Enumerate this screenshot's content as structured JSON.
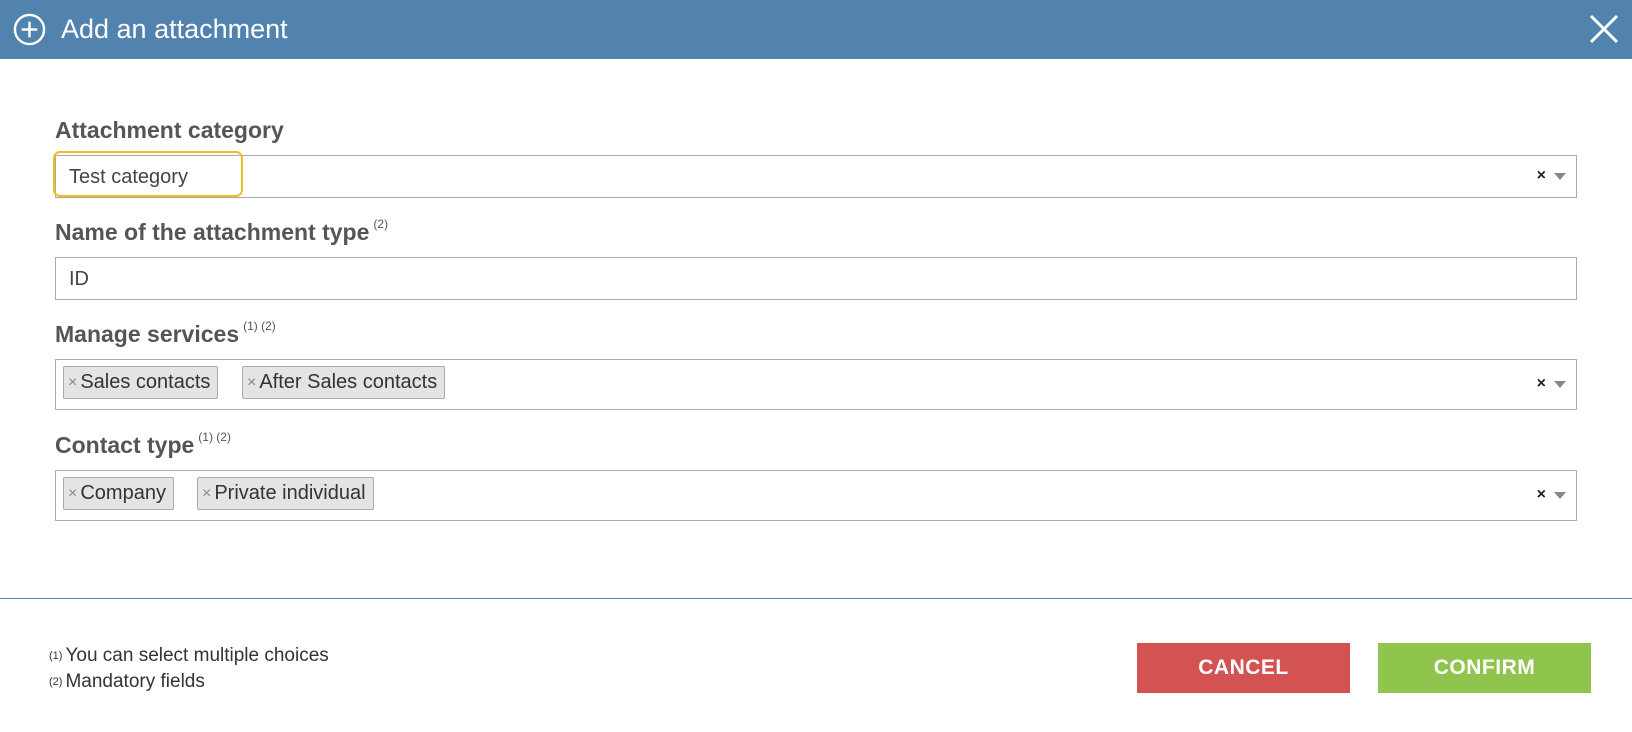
{
  "dialog": {
    "title": "Add an attachment"
  },
  "fields": {
    "category": {
      "label": "Attachment category",
      "value": "Test category"
    },
    "type_name": {
      "label": "Name of the attachment type",
      "marks": "(2)",
      "value": "ID"
    },
    "services": {
      "label": "Manage services",
      "marks": "(1) (2)",
      "tags": [
        "Sales contacts",
        "After Sales contacts"
      ]
    },
    "contact_type": {
      "label": "Contact type",
      "marks": "(1) (2)",
      "tags": [
        "Company",
        "Private individual"
      ]
    }
  },
  "footer": {
    "notes": [
      {
        "mark": "(1)",
        "text": "You can select multiple choices"
      },
      {
        "mark": "(2)",
        "text": "Mandatory fields"
      }
    ],
    "cancel_label": "CANCEL",
    "confirm_label": "CONFIRM"
  },
  "colors": {
    "header": "#5282ae",
    "cancel": "#d35353",
    "confirm": "#8fc54d",
    "highlight": "#f0c020"
  },
  "icons": {
    "header": "plus-circle-icon",
    "close": "close-icon"
  }
}
